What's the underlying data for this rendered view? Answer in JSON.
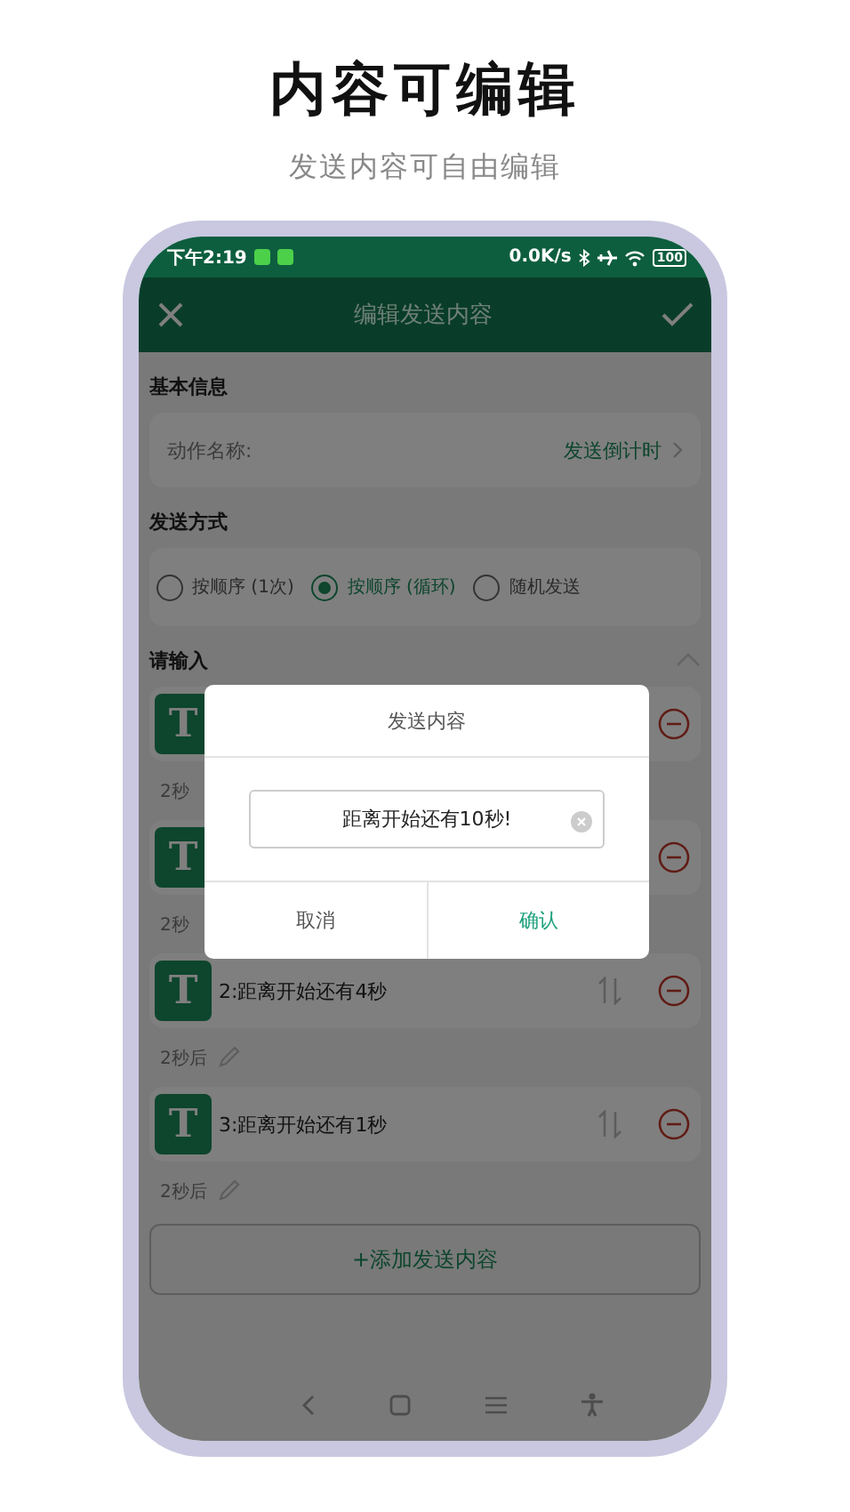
{
  "header": {
    "title": "内容可编辑",
    "subtitle": "发送内容可自由编辑"
  },
  "status_bar": {
    "time": "下午2:19",
    "speed": "0.0K/s",
    "battery": "100"
  },
  "app_bar": {
    "title": "编辑发送内容"
  },
  "basic_info": {
    "heading": "基本信息",
    "field_label": "动作名称:",
    "field_value": "发送倒计时"
  },
  "send_mode": {
    "heading": "发送方式",
    "options": [
      {
        "label": "按顺序 (1次)",
        "selected": false
      },
      {
        "label": "按顺序 (循环)",
        "selected": true
      },
      {
        "label": "随机发送",
        "selected": false
      }
    ]
  },
  "content": {
    "heading": "请输入",
    "items": [
      {
        "icon": "T",
        "delay": "2秒"
      },
      {
        "icon": "T",
        "delay": "2秒"
      },
      {
        "icon": "T",
        "text": "2:距离开始还有4秒",
        "delay": "2秒后"
      },
      {
        "icon": "T",
        "text": "3:距离开始还有1秒",
        "delay": "2秒后"
      }
    ]
  },
  "add_button": "+添加发送内容",
  "dialog": {
    "title": "发送内容",
    "value": "距离开始还有10秒!",
    "buttons": [
      {
        "label": "取消",
        "kind": "cancel"
      },
      {
        "label": "确认",
        "kind": "confirm"
      }
    ]
  }
}
